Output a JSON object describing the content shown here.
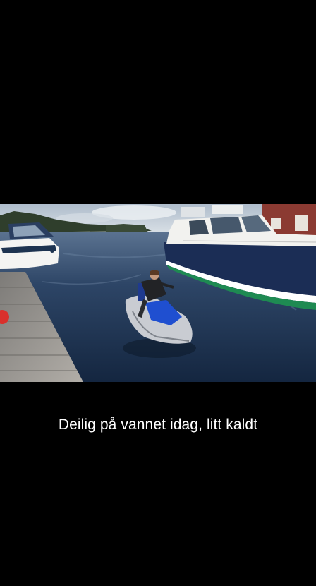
{
  "post": {
    "caption": "Deilig på vannet idag, litt kaldt"
  },
  "photo": {
    "subject": "person-on-jet-ski",
    "colors": {
      "sky": "#c9d2dc",
      "water": "#1f3654",
      "boat_hull": "#1b2d55",
      "hull_stripe": "#1e8a52",
      "dock": "#9a9792",
      "jetski_accent": "#1f4fd0"
    }
  }
}
